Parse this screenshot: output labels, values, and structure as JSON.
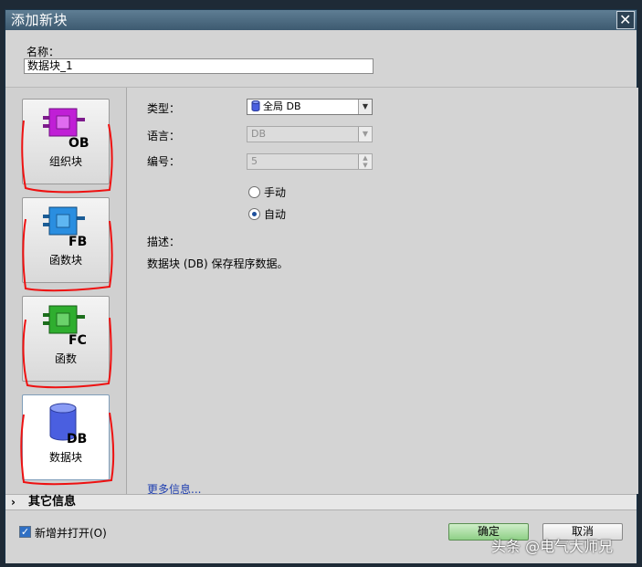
{
  "window": {
    "title": "添加新块",
    "close_glyph": "✕"
  },
  "name_field": {
    "label": "名称：",
    "value": "数据块_1"
  },
  "block_types": [
    {
      "id": "ob",
      "label": "组织块",
      "code": "OB",
      "icon": "ob-block-icon",
      "color": "#c01fd6",
      "selected": false
    },
    {
      "id": "fb",
      "label": "函数块",
      "code": "FB",
      "icon": "fb-block-icon",
      "color": "#2a8ee0",
      "selected": false
    },
    {
      "id": "fc",
      "label": "函数",
      "code": "FC",
      "icon": "fc-block-icon",
      "color": "#2fae2f",
      "selected": false
    },
    {
      "id": "db",
      "label": "数据块",
      "code": "DB",
      "icon": "db-block-icon",
      "color": "#4a5fe0",
      "selected": true
    }
  ],
  "properties": {
    "type_label": "类型：",
    "type_value": "全局 DB",
    "language_label": "语言：",
    "language_value": "DB",
    "number_label": "编号：",
    "number_value": "5",
    "radio_manual": "手动",
    "radio_auto": "自动",
    "selected_radio": "auto",
    "description_label": "描述：",
    "description_text": "数据块 (DB) 保存程序数据。",
    "more_info": "更多信息..."
  },
  "other_info": {
    "chevron": "›",
    "label": "其它信息"
  },
  "footer": {
    "add_and_open_label": "新增并打开(O)",
    "add_and_open_checked": true,
    "ok_label": "确定",
    "cancel_label": "取消"
  },
  "watermark": "头条 @电气大师兄"
}
